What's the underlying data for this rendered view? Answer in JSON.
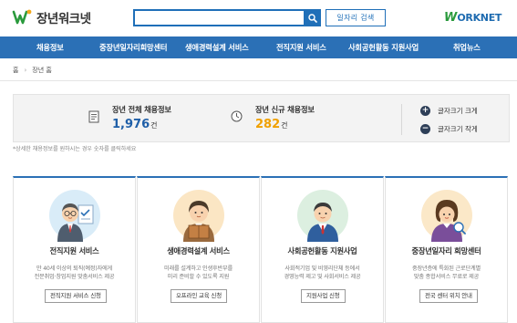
{
  "header": {
    "logo_text": "장년워크넷",
    "search_placeholder": "",
    "search_value": "",
    "job_search_label": "일자리 검색",
    "worknet_w": "W",
    "worknet_rest": "ORKNET"
  },
  "nav": {
    "items": [
      {
        "label": "채용정보"
      },
      {
        "label": "중장년일자리희망센터"
      },
      {
        "label": "생애경력설계 서비스"
      },
      {
        "label": "전직지원 서비스"
      },
      {
        "label": "사회공헌활동 지원사업"
      },
      {
        "label": "취업뉴스"
      }
    ]
  },
  "breadcrumb": {
    "home": "홈",
    "current": "장년 홈"
  },
  "stats": {
    "total_label": "장년 전체 채용정보",
    "total_value": "1,976",
    "total_unit": "건",
    "new_label": "장년 신규 채용정보",
    "new_value": "282",
    "new_unit": "건"
  },
  "font_controls": {
    "larger": "글자크기 크게",
    "smaller": "글자크기 작게"
  },
  "note": "*상세한 채용정보를 원하시는 경우 숫자를 클릭하세요",
  "cards": [
    {
      "title": "전직지원 서비스",
      "desc1": "만 40세 이상의 퇴직(예정)자에게",
      "desc2": "전문취업·창업지원 맞춤서비스 제공",
      "button": "전직지원 서비스 신청"
    },
    {
      "title": "생애경력설계 서비스",
      "desc1": "미래를 설계하고 인생후반부를",
      "desc2": "미리 준비할 수 있도록 지원",
      "button": "오프라인 교육 신청"
    },
    {
      "title": "사회공헌활동 지원사업",
      "desc1": "사회적기업 및 비영리단체 등에서",
      "desc2": "경영능력 제고 및 사회서비스 제공",
      "button": "지원사업 신청"
    },
    {
      "title": "중장년일자리 희망센터",
      "desc1": "중장년층에 특화된 근로단계별",
      "desc2": "맞춤 종합서비스 무료로 제공",
      "button": "전국 센터 위치 안내"
    }
  ],
  "colors": {
    "nav_bg": "#2b70b6",
    "accent_blue": "#1f5fa8",
    "accent_orange": "#f0a000"
  }
}
